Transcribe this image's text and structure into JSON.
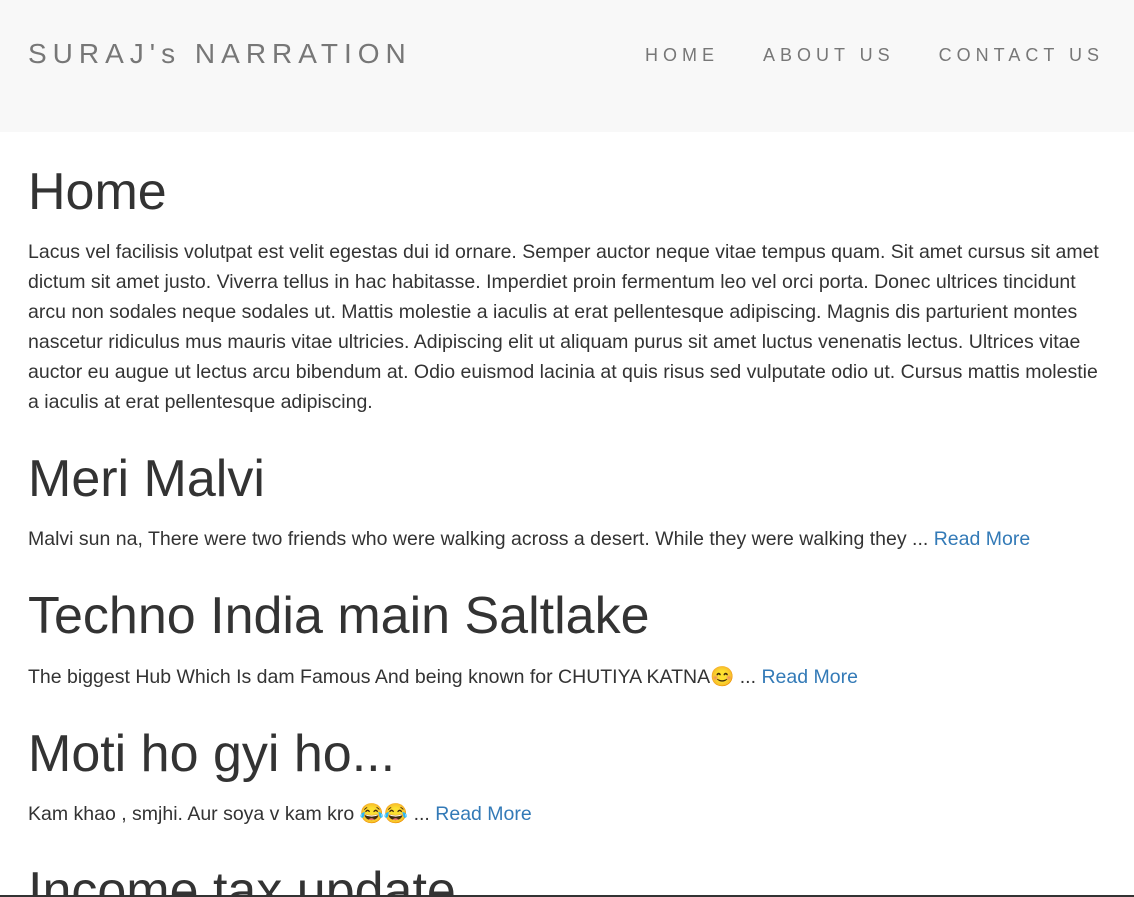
{
  "navbar": {
    "brand": "SURAJ's NARRATION",
    "links": [
      {
        "label": "HOME"
      },
      {
        "label": "ABOUT US"
      },
      {
        "label": "CONTACT US"
      }
    ]
  },
  "main": {
    "title": "Home",
    "intro": "Lacus vel facilisis volutpat est velit egestas dui id ornare. Semper auctor neque vitae tempus quam. Sit amet cursus sit amet dictum sit amet justo. Viverra tellus in hac habitasse. Imperdiet proin fermentum leo vel orci porta. Donec ultrices tincidunt arcu non sodales neque sodales ut. Mattis molestie a iaculis at erat pellentesque adipiscing. Magnis dis parturient montes nascetur ridiculus mus mauris vitae ultricies. Adipiscing elit ut aliquam purus sit amet luctus venenatis lectus. Ultrices vitae auctor eu augue ut lectus arcu bibendum at. Odio euismod lacinia at quis risus sed vulputate odio ut. Cursus mattis molestie a iaculis at erat pellentesque adipiscing.",
    "posts": [
      {
        "title": "Meri Malvi",
        "excerpt": "Malvi sun na, There were two friends who were walking across a desert. While they were walking they ... ",
        "read_more": "Read More"
      },
      {
        "title": "Techno India main Saltlake",
        "excerpt": "The biggest Hub Which Is dam Famous And being known for CHUTIYA KATNA😊 ... ",
        "read_more": "Read More"
      },
      {
        "title": "Moti ho gyi ho...",
        "excerpt": "Kam khao , smjhi. Aur soya v kam kro 😂😂 ... ",
        "read_more": "Read More"
      },
      {
        "title": "Income tax update",
        "excerpt": "",
        "read_more": ""
      }
    ]
  },
  "colors": {
    "navbar_bg": "#f8f8f8",
    "nav_text": "#777777",
    "body_text": "#333333",
    "link": "#337ab7"
  }
}
